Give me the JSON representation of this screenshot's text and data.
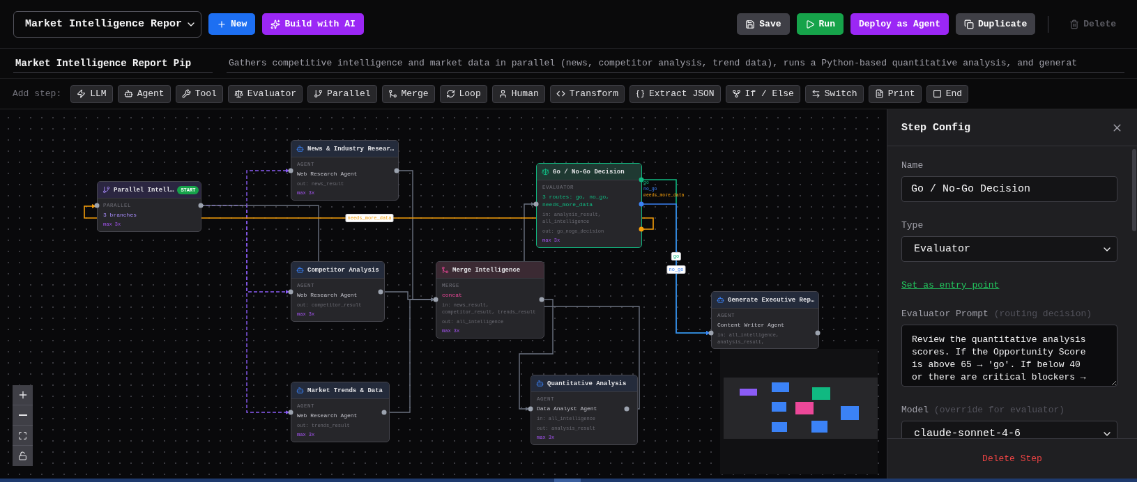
{
  "workflow_select": {
    "value": "Market Intelligence Repor"
  },
  "create_buttons": [
    {
      "kind": "new",
      "label": "New"
    },
    {
      "kind": "ai",
      "label": "Build with AI"
    }
  ],
  "actions": [
    {
      "kind": "save",
      "label": "Save",
      "disabled": false
    },
    {
      "kind": "run",
      "label": "Run",
      "disabled": false
    },
    {
      "kind": "deploy",
      "label": "Deploy as Agent",
      "disabled": false
    },
    {
      "kind": "duplicate",
      "label": "Duplicate",
      "disabled": false
    },
    {
      "kind": "delete",
      "label": "Delete",
      "disabled": true
    }
  ],
  "name_field": {
    "value": "Market Intelligence Report Pip"
  },
  "description_field": {
    "value": "Gathers competitive intelligence and market data in parallel (news, competitor analysis, trend data), runs a Python-based quantitative analysis, and generat"
  },
  "step_toolbar": {
    "label": "Add step:",
    "steps": [
      {
        "kind": "llm",
        "label": "LLM"
      },
      {
        "kind": "agent",
        "label": "Agent"
      },
      {
        "kind": "tool",
        "label": "Tool"
      },
      {
        "kind": "evaluator",
        "label": "Evaluator"
      },
      {
        "kind": "parallel",
        "label": "Parallel"
      },
      {
        "kind": "merge",
        "label": "Merge"
      },
      {
        "kind": "loop",
        "label": "Loop"
      },
      {
        "kind": "human",
        "label": "Human"
      },
      {
        "kind": "transform",
        "label": "Transform"
      },
      {
        "kind": "extract",
        "label": "Extract JSON"
      },
      {
        "kind": "ifelse",
        "label": "If / Else"
      },
      {
        "kind": "switch",
        "label": "Switch"
      },
      {
        "kind": "print",
        "label": "Print"
      },
      {
        "kind": "end",
        "label": "End"
      }
    ]
  },
  "canvas": {
    "nodes": [
      {
        "kind": "parallel",
        "title": "Parallel Intell…",
        "badge": "START",
        "type_label": "PARALLEL",
        "detail": "3 branches",
        "retries": "max 3x",
        "selected": false
      },
      {
        "kind": "agent",
        "title": "News & Industry Resear…",
        "type_label": "AGENT",
        "detail": "Web Research Agent",
        "output": "out: news_result",
        "retries": "max 3x",
        "selected": false
      },
      {
        "kind": "agent",
        "title": "Competitor Analysis",
        "type_label": "AGENT",
        "detail": "Web Research Agent",
        "output": "out: competitor_result",
        "retries": "max 3x",
        "selected": false
      },
      {
        "kind": "agent",
        "title": "Market Trends & Data",
        "type_label": "AGENT",
        "detail": "Web Research Agent",
        "output": "out: trends_result",
        "retries": "max 3x",
        "selected": false
      },
      {
        "kind": "merge",
        "title": "Merge Intelligence",
        "type_label": "MERGE",
        "detail": "concat",
        "inputs": "in: news_result, competitor_result, trends_result",
        "output": "out: all_intelligence",
        "retries": "max 3x",
        "selected": false
      },
      {
        "kind": "evaluator",
        "title": "Go / No-Go Decision",
        "type_label": "EVALUATOR",
        "detail": "3 routes: go, no_go, needs_more_data",
        "inputs": "in: analysis_result, all_intelligence",
        "output": "out: go_nogo_decision",
        "retries": "max 3x",
        "selected": true,
        "routes": [
          {
            "name": "go",
            "color": "#10b981"
          },
          {
            "name": "no_go",
            "color": "#3b82f6"
          },
          {
            "name": "needs_more_data",
            "color": "#f59e0b"
          }
        ]
      },
      {
        "kind": "agent",
        "title": "Quantitative Analysis",
        "type_label": "AGENT",
        "detail": "Data Analyst Agent",
        "inputs": "in: all_intelligence",
        "output": "out: analysis_result",
        "retries": "max 3x",
        "selected": false
      },
      {
        "kind": "agent",
        "title": "Generate Executive Rep…",
        "type_label": "AGENT",
        "detail": "Content Writer Agent",
        "inputs": "in: all_intelligence, analysis_result,",
        "selected": false
      }
    ],
    "edges": [
      {
        "kind": "branch"
      },
      {
        "kind": "branch"
      },
      {
        "kind": "branch"
      },
      {
        "kind": "flow"
      },
      {
        "kind": "flow"
      },
      {
        "kind": "flow"
      },
      {
        "kind": "flow"
      },
      {
        "kind": "flow"
      },
      {
        "kind": "link"
      },
      {
        "kind": "route",
        "color": "#f59e0b",
        "label": "needs_more_data"
      },
      {
        "kind": "route",
        "color": "#10b981",
        "label": "go"
      },
      {
        "kind": "route",
        "color": "#3b82f6",
        "label": "no_go"
      }
    ]
  },
  "step_config": {
    "title": "Step Config",
    "fields": [
      {
        "kind": "text",
        "label": "Name",
        "value": "Go / No-Go Decision"
      },
      {
        "kind": "select",
        "label": "Type",
        "value": "Evaluator"
      },
      {
        "kind": "link",
        "label": "Set as entry point"
      },
      {
        "kind": "textarea",
        "label": "Evaluator Prompt",
        "hint": "(routing decision)",
        "value": "Review the quantitative analysis scores. If the Opportunity Score is above 65 → 'go'. If below 40 or there are critical blockers →"
      },
      {
        "kind": "select",
        "label": "Model",
        "hint": "(override for evaluator)",
        "value": "claude-sonnet-4-6"
      }
    ],
    "delete_label": "Delete Step"
  }
}
